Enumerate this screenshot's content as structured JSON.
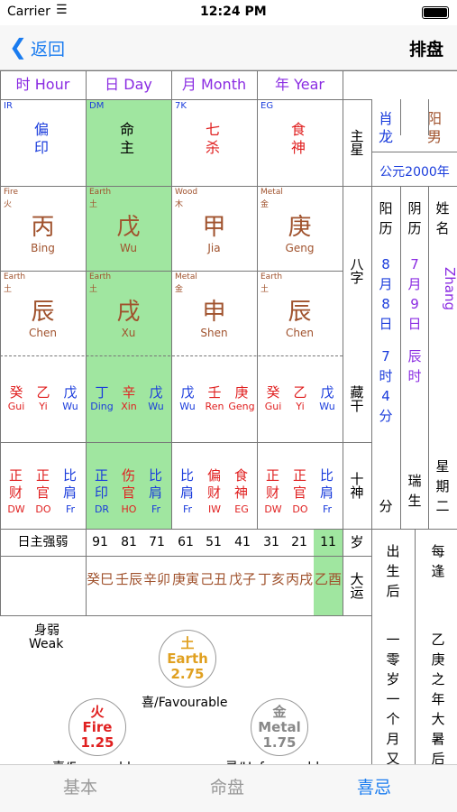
{
  "status": {
    "carrier": "Carrier",
    "time": "12:24 PM"
  },
  "nav": {
    "back": "返回",
    "title": "排盘"
  },
  "headers": [
    "时 Hour",
    "日 Day",
    "月 Month",
    "年 Year"
  ],
  "ten_gods_top": [
    {
      "abbr": "IR",
      "text": "偏印",
      "color": "#1a3cdc"
    },
    {
      "abbr": "DM",
      "text": "命主",
      "color": "#000"
    },
    {
      "abbr": "7K",
      "text": "七杀",
      "color": "#e02020"
    },
    {
      "abbr": "EG",
      "text": "食神",
      "color": "#e02020"
    }
  ],
  "zhu_xing": "主星",
  "shengxiao": "肖龙",
  "gender": "阳男",
  "year_ad": "公元2000年",
  "stems": [
    {
      "el": "Fire",
      "elz": "火",
      "ch": "丙",
      "py": "Bing",
      "color": "#a0522d"
    },
    {
      "el": "Earth",
      "elz": "土",
      "ch": "戊",
      "py": "Wu",
      "color": "#a0522d"
    },
    {
      "el": "Wood",
      "elz": "木",
      "ch": "甲",
      "py": "Jia",
      "color": "#a0522d"
    },
    {
      "el": "Metal",
      "elz": "金",
      "ch": "庚",
      "py": "Geng",
      "color": "#a0522d"
    }
  ],
  "branches": [
    {
      "el": "Earth",
      "elz": "土",
      "ch": "辰",
      "py": "Chen"
    },
    {
      "el": "Earth",
      "elz": "土",
      "ch": "戌",
      "py": "Xu"
    },
    {
      "el": "Metal",
      "elz": "金",
      "ch": "申",
      "py": "Shen"
    },
    {
      "el": "Earth",
      "elz": "土",
      "ch": "辰",
      "py": "Chen"
    }
  ],
  "bazi": "八字",
  "solar_label": "阳历",
  "solar_date": "8月8日",
  "solar_time": "7时4分",
  "lunar_label": "阴历",
  "lunar_date": "7月9日",
  "lunar_time": "辰时",
  "lunar_extra": "瑞生",
  "name_label": "姓名",
  "name": "Zhang",
  "weekday": "星期二",
  "hidden": [
    [
      {
        "c": "癸",
        "p": "Gui",
        "col": "#e02020"
      },
      {
        "c": "乙",
        "p": "Yi",
        "col": "#e02020"
      },
      {
        "c": "戊",
        "p": "Wu",
        "col": "#1a3cdc"
      }
    ],
    [
      {
        "c": "丁",
        "p": "Ding",
        "col": "#1a3cdc"
      },
      {
        "c": "辛",
        "p": "Xin",
        "col": "#e02020"
      },
      {
        "c": "戊",
        "p": "Wu",
        "col": "#1a3cdc"
      }
    ],
    [
      {
        "c": "戊",
        "p": "Wu",
        "col": "#1a3cdc"
      },
      {
        "c": "壬",
        "p": "Ren",
        "col": "#e02020"
      },
      {
        "c": "庚",
        "p": "Geng",
        "col": "#e02020"
      }
    ],
    [
      {
        "c": "癸",
        "p": "Gui",
        "col": "#e02020"
      },
      {
        "c": "乙",
        "p": "Yi",
        "col": "#e02020"
      },
      {
        "c": "戊",
        "p": "Wu",
        "col": "#1a3cdc"
      }
    ]
  ],
  "canggan": "藏干",
  "gods": [
    [
      {
        "c": "正财",
        "a": "DW",
        "col": "#e02020"
      },
      {
        "c": "正官",
        "a": "DO",
        "col": "#e02020"
      },
      {
        "c": "比肩",
        "a": "Fr",
        "col": "#1a3cdc"
      }
    ],
    [
      {
        "c": "正印",
        "a": "DR",
        "col": "#1a3cdc"
      },
      {
        "c": "伤官",
        "a": "HO",
        "col": "#e02020"
      },
      {
        "c": "比肩",
        "a": "Fr",
        "col": "#1a3cdc"
      }
    ],
    [
      {
        "c": "比肩",
        "a": "Fr",
        "col": "#1a3cdc"
      },
      {
        "c": "偏财",
        "a": "IW",
        "col": "#e02020"
      },
      {
        "c": "食神",
        "a": "EG",
        "col": "#e02020"
      }
    ],
    [
      {
        "c": "正财",
        "a": "DW",
        "col": "#e02020"
      },
      {
        "c": "正官",
        "a": "DO",
        "col": "#e02020"
      },
      {
        "c": "比肩",
        "a": "Fr",
        "col": "#1a3cdc"
      }
    ]
  ],
  "shishen": "十神",
  "strength_label": "日主强弱",
  "ages": [
    "91",
    "81",
    "71",
    "61",
    "51",
    "41",
    "31",
    "21",
    "11"
  ],
  "sui": "岁",
  "luck": [
    "癸巳",
    "壬辰",
    "辛卯",
    "庚寅",
    "己丑",
    "戊子",
    "丁亥",
    "丙戌",
    "乙酉"
  ],
  "dayun": "大运",
  "chushenghou": "出生后",
  "meifeng": "每逢",
  "after_text": "一零岁一个月又十",
  "meifeng_text": "乙庚之年大暑后八",
  "weak_zh": "身弱",
  "weak_en": "Weak",
  "earth": {
    "zh": "土",
    "en": "Earth",
    "val": "2.75",
    "color": "#e0a020"
  },
  "fav_label": "喜/Favourable",
  "fire": {
    "zh": "火",
    "en": "Fire",
    "val": "1.25",
    "color": "#e02020"
  },
  "fav_label2": "喜/Favourable",
  "metal": {
    "zh": "金",
    "en": "Metal",
    "val": "1.75",
    "color": "#888"
  },
  "unfav_label": "忌/Unfavourable",
  "tabs": [
    "基本",
    "命盘",
    "喜忌"
  ]
}
